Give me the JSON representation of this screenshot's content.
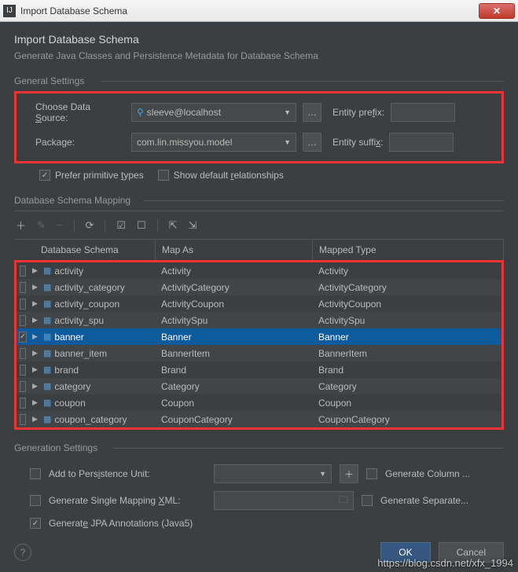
{
  "window": {
    "title": "Import Database Schema"
  },
  "header": {
    "title": "Import Database Schema",
    "subtitle": "Generate Java Classes and Persistence Metadata for Database Schema"
  },
  "sections": {
    "general": "General Settings",
    "mapping": "Database Schema Mapping",
    "generation": "Generation Settings"
  },
  "general": {
    "data_source_label": "Choose Data Source:",
    "data_source_value": "sleeve@localhost",
    "package_label": "Package:",
    "package_value": "com.lin.missyou.model",
    "entity_prefix_label": "Entity prefix:",
    "entity_prefix_value": "",
    "entity_suffix_label": "Entity suffix:",
    "entity_suffix_value": "",
    "prefer_primitive": "Prefer primitive types",
    "show_default_rel": "Show default relationships"
  },
  "table": {
    "headers": {
      "c1": "Database Schema",
      "c2": "Map As",
      "c3": "Mapped Type"
    },
    "rows": [
      {
        "checked": false,
        "name": "activity",
        "mapAs": "Activity",
        "mappedType": "Activity"
      },
      {
        "checked": false,
        "name": "activity_category",
        "mapAs": "ActivityCategory",
        "mappedType": "ActivityCategory"
      },
      {
        "checked": false,
        "name": "activity_coupon",
        "mapAs": "ActivityCoupon",
        "mappedType": "ActivityCoupon"
      },
      {
        "checked": false,
        "name": "activity_spu",
        "mapAs": "ActivitySpu",
        "mappedType": "ActivitySpu"
      },
      {
        "checked": true,
        "name": "banner",
        "mapAs": "Banner",
        "mappedType": "Banner"
      },
      {
        "checked": false,
        "name": "banner_item",
        "mapAs": "BannerItem",
        "mappedType": "BannerItem"
      },
      {
        "checked": false,
        "name": "brand",
        "mapAs": "Brand",
        "mappedType": "Brand"
      },
      {
        "checked": false,
        "name": "category",
        "mapAs": "Category",
        "mappedType": "Category"
      },
      {
        "checked": false,
        "name": "coupon",
        "mapAs": "Coupon",
        "mappedType": "Coupon"
      },
      {
        "checked": false,
        "name": "coupon_category",
        "mapAs": "CouponCategory",
        "mappedType": "CouponCategory"
      }
    ]
  },
  "generation": {
    "add_persistence": "Add to Persistence Unit:",
    "gen_column": "Generate Column ...",
    "single_mapping": "Generate Single Mapping XML:",
    "gen_separate": "Generate Separate...",
    "jpa_annotations": "Generate JPA Annotations (Java5)"
  },
  "buttons": {
    "ok": "OK",
    "cancel": "Cancel"
  },
  "watermark": "https://blog.csdn.net/xfx_1994"
}
